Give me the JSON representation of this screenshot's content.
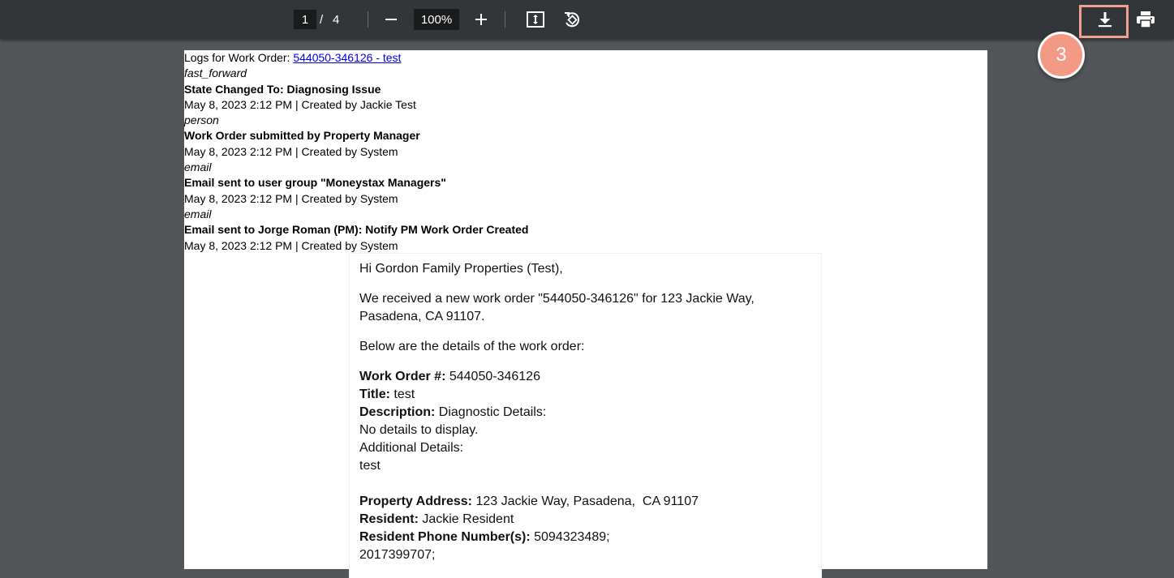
{
  "toolbar": {
    "current_page": "1",
    "page_separator": "/",
    "total_pages": "4",
    "zoom_level": "100%",
    "icons": [
      "zoom-out-icon",
      "zoom-in-icon",
      "fit-page-icon",
      "rotate-icon",
      "download-icon",
      "print-icon"
    ]
  },
  "annotation": {
    "step_number": "3",
    "highlight_color": "#f0a090"
  },
  "log": {
    "header_prefix": "Logs for Work Order:",
    "header_link": "544050-346126 - test",
    "entries": [
      {
        "icon": "fast_forward",
        "title": "State Changed To: Diagnosing Issue",
        "meta": "May 8, 2023 2:12 PM | Created by Jackie Test"
      },
      {
        "icon": "person",
        "title": "Work Order submitted by Property Manager",
        "meta": "May 8, 2023 2:12 PM | Created by System"
      },
      {
        "icon": "email",
        "title": "Email sent to user group \"Moneystax Managers\"",
        "meta": "May 8, 2023 2:12 PM | Created by System"
      },
      {
        "icon": "email",
        "title": "Email sent to Jorge Roman (PM): Notify PM Work Order Created",
        "meta": "May 8, 2023 2:12 PM | Created by System"
      }
    ]
  },
  "email": {
    "greeting": "Hi Gordon Family Properties (Test),",
    "intro_line1": "We received a new work order \"544050-346126\" for 123 Jackie Way,",
    "intro_line2": "Pasadena, CA 91107.",
    "details_intro": "Below are the details of the work order:",
    "work_order_label": "Work Order #:",
    "work_order_value": " 544050-346126",
    "title_label": "Title:",
    "title_value": " test",
    "description_label": "Description:",
    "description_value": " Diagnostic Details:",
    "description_line2": "No details to display.",
    "description_line3": "Additional Details:",
    "description_line4": "test",
    "address_label": "Property Address:",
    "address_value": " 123 Jackie Way, Pasadena,  CA 91107",
    "resident_label": "Resident:",
    "resident_value": " Jackie Resident",
    "phone_label": "Resident Phone Number(s):",
    "phone_value": " 5094323489;",
    "phone_line2": "2017399707;"
  }
}
